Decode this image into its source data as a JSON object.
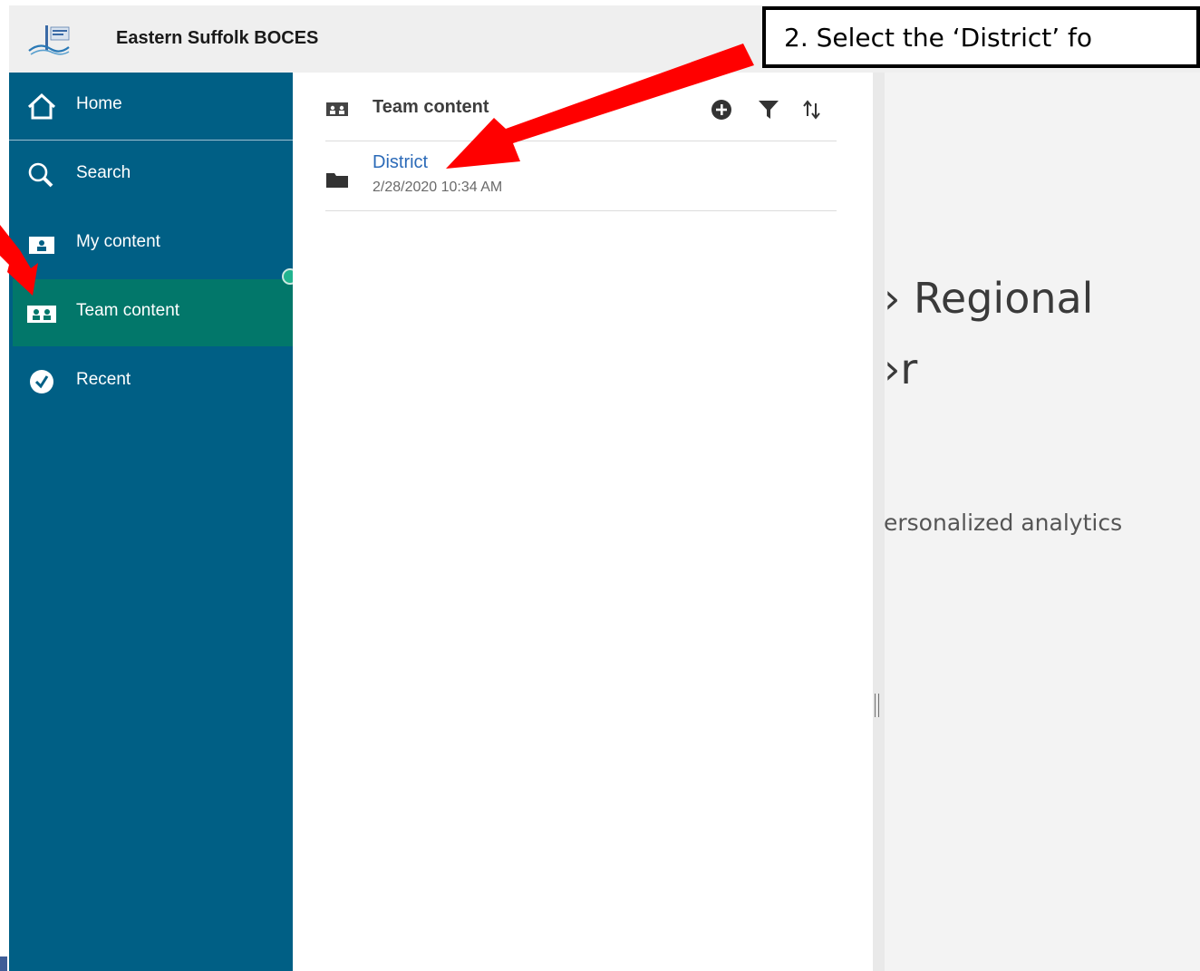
{
  "header": {
    "org_name": "Eastern Suffolk BOCES"
  },
  "sidebar": {
    "items": [
      {
        "label": "Home",
        "icon": "home-icon"
      },
      {
        "label": "Search",
        "icon": "search-icon"
      },
      {
        "label": "My content",
        "icon": "my-content-icon"
      },
      {
        "label": "Team content",
        "icon": "team-content-icon",
        "selected": true
      },
      {
        "label": "Recent",
        "icon": "recent-icon"
      }
    ]
  },
  "panel": {
    "title": "Team content",
    "tools": [
      "add-icon",
      "filter-icon",
      "sort-icon"
    ],
    "rows": [
      {
        "name": "District",
        "date": "2/28/2020 10:34 AM",
        "icon": "folder-icon"
      }
    ]
  },
  "background": {
    "line1": "› Regional",
    "line2": "›r",
    "subtitle": "ersonalized analytics"
  },
  "annotation": {
    "callout_text": "2. Select the ‘District’ fo"
  },
  "colors": {
    "sidebar": "#005f85",
    "selected": "#02776a",
    "link": "#2b6ab8",
    "arrow": "#ff0000"
  }
}
